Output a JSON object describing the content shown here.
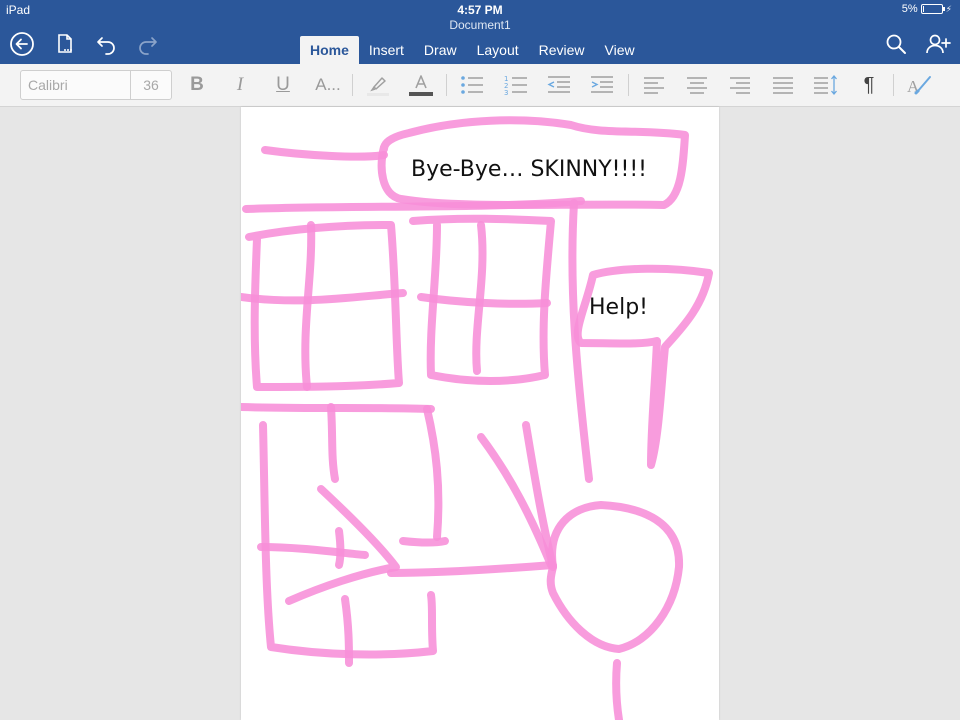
{
  "status_bar": {
    "device": "iPad",
    "time": "4:57 PM",
    "battery": "5%",
    "battery_level": 0.05
  },
  "document": {
    "title": "Document1"
  },
  "toolbar": {
    "icons": [
      "back-icon",
      "file-icon",
      "undo-icon",
      "redo-icon",
      "search-icon",
      "share-person-icon"
    ]
  },
  "tabs": [
    {
      "label": "Home",
      "active": true
    },
    {
      "label": "Insert",
      "active": false
    },
    {
      "label": "Draw",
      "active": false
    },
    {
      "label": "Layout",
      "active": false
    },
    {
      "label": "Review",
      "active": false
    },
    {
      "label": "View",
      "active": false
    }
  ],
  "ribbon": {
    "font_name": "Calibri",
    "font_size": "36",
    "bold": "B",
    "italic": "I",
    "underline": "U",
    "font_effects": "A...",
    "paragraph_mark": "¶",
    "font_color": "#555555",
    "icons": [
      "highlighter-icon",
      "font-color-icon",
      "bullet-list-icon",
      "numbered-list-icon",
      "decrease-indent-icon",
      "increase-indent-icon",
      "align-left-icon",
      "align-center-icon",
      "align-right-icon",
      "justify-icon",
      "line-spacing-icon",
      "styles-icon"
    ]
  },
  "page_content": {
    "bubble1_text": "Bye-Bye… SKINNY!!!!",
    "bubble2_text": "Help!",
    "ink_color": "#f78ed8"
  }
}
